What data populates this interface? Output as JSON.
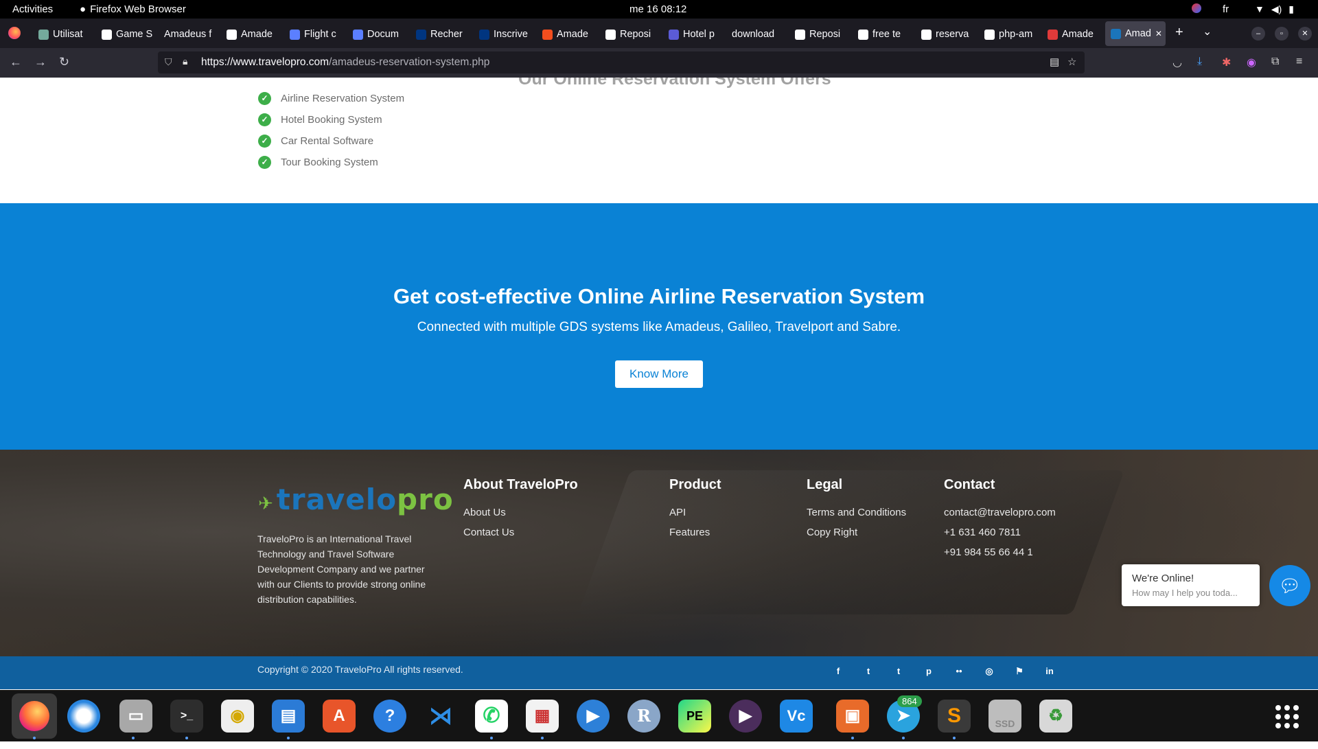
{
  "system_bar": {
    "activities": "Activities",
    "app_name": "Firefox Web Browser",
    "clock": "me 16  08:12",
    "language": "fr"
  },
  "tabs": [
    {
      "label": "Utilisat",
      "icon": "chatgpt-icon",
      "color": "#74aa9c"
    },
    {
      "label": "Game S",
      "icon": "board-icon",
      "color": "#ffffff"
    },
    {
      "label": "Amadeus f",
      "icon": "",
      "color": ""
    },
    {
      "label": "Amade",
      "icon": "board-icon",
      "color": "#ffffff"
    },
    {
      "label": "Flight c",
      "icon": "at-icon",
      "color": "#5b7fff"
    },
    {
      "label": "Docum",
      "icon": "at-icon",
      "color": "#5b7fff"
    },
    {
      "label": "Recher",
      "icon": "booking-icon",
      "color": "#003580"
    },
    {
      "label": "Inscrive",
      "icon": "booking-icon",
      "color": "#003580"
    },
    {
      "label": "Amade",
      "icon": "figma-icon",
      "color": "#f24e1e"
    },
    {
      "label": "Reposi",
      "icon": "github-icon",
      "color": "#ffffff"
    },
    {
      "label": "Hotel p",
      "icon": "doc-icon",
      "color": "#5b5bd6"
    },
    {
      "label": "download",
      "icon": "",
      "color": ""
    },
    {
      "label": "Reposi",
      "icon": "github-icon",
      "color": "#ffffff"
    },
    {
      "label": "free te",
      "icon": "google-icon",
      "color": "#ffffff"
    },
    {
      "label": "reserva",
      "icon": "google-icon",
      "color": "#ffffff"
    },
    {
      "label": "php-am",
      "icon": "github-icon",
      "color": "#ffffff"
    },
    {
      "label": "Amade",
      "icon": "target-icon",
      "color": "#e03a3a"
    },
    {
      "label": "Amad",
      "icon": "travelopro-icon",
      "color": "#1b75bb"
    }
  ],
  "url": {
    "host": "https://www.travelopro.com",
    "path": "/amadeus-reservation-system.php"
  },
  "page": {
    "cut_heading": "Our Online Reservation System Offers",
    "features": [
      "Airline Reservation System",
      "Hotel Booking System",
      "Car Rental Software",
      "Tour Booking System"
    ],
    "cta": {
      "title": "Get cost-effective Online Airline Reservation System",
      "subtitle": "Connected with multiple GDS systems like Amadeus, Galileo, Travelport and Sabre.",
      "button": "Know More",
      "background": "#0a82d5"
    },
    "footer": {
      "logo_text_1": "travelo",
      "logo_text_2": "pro",
      "about_text": "TraveloPro is an International Travel Technology and Travel Software Development Company and we partner with our Clients to provide strong online distribution capabilities.",
      "columns": [
        {
          "title": "About TraveloPro",
          "links": [
            "About Us",
            "Contact Us"
          ]
        },
        {
          "title": "Product",
          "links": [
            "API",
            "Features"
          ]
        },
        {
          "title": "Legal",
          "links": [
            "Terms and Conditions",
            "Copy Right"
          ]
        },
        {
          "title": "Contact",
          "links": [
            "contact@travelopro.com",
            "+1 631 460 7811",
            "+91 984 55 66 44 1"
          ]
        }
      ],
      "copyright": "Copyright © 2020 TraveloPro All rights reserved.",
      "social": [
        "f",
        "t",
        "t",
        "p",
        "••",
        "◎",
        "⚑",
        "in"
      ]
    },
    "chat": {
      "title": "We're Online!",
      "subtitle": "How may I help you toda..."
    }
  },
  "dock": {
    "telegram_badge": "864",
    "apps": [
      "firefox-icon",
      "thunderbird-icon",
      "files-icon",
      "terminal-icon",
      "rhythmbox-icon",
      "writer-icon",
      "software-icon",
      "help-icon",
      "vscode-icon",
      "whatsapp-icon",
      "document-viewer-icon",
      "screen-recorder-icon",
      "r-icon",
      "pycharm-icon",
      "media-player-icon",
      "vcode-icon",
      "impress-icon",
      "telegram-icon",
      "sublime-icon",
      "ssd-icon",
      "trash-icon"
    ]
  }
}
